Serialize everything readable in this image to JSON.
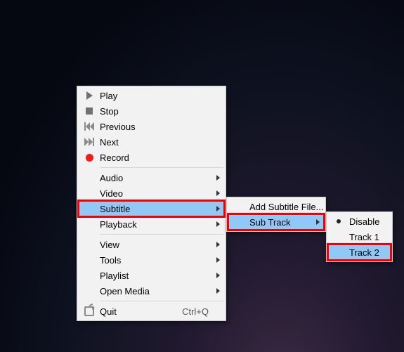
{
  "main_menu": {
    "play": "Play",
    "stop": "Stop",
    "previous": "Previous",
    "next": "Next",
    "record": "Record",
    "audio": "Audio",
    "video": "Video",
    "subtitle": "Subtitle",
    "playback": "Playback",
    "view": "View",
    "tools": "Tools",
    "playlist": "Playlist",
    "open_media": "Open Media",
    "quit": "Quit",
    "quit_shortcut": "Ctrl+Q"
  },
  "subtitle_menu": {
    "add_subtitle_file": "Add Subtitle File...",
    "sub_track": "Sub Track"
  },
  "subtrack_menu": {
    "disable": "Disable",
    "track1": "Track 1",
    "track2": "Track 2"
  }
}
